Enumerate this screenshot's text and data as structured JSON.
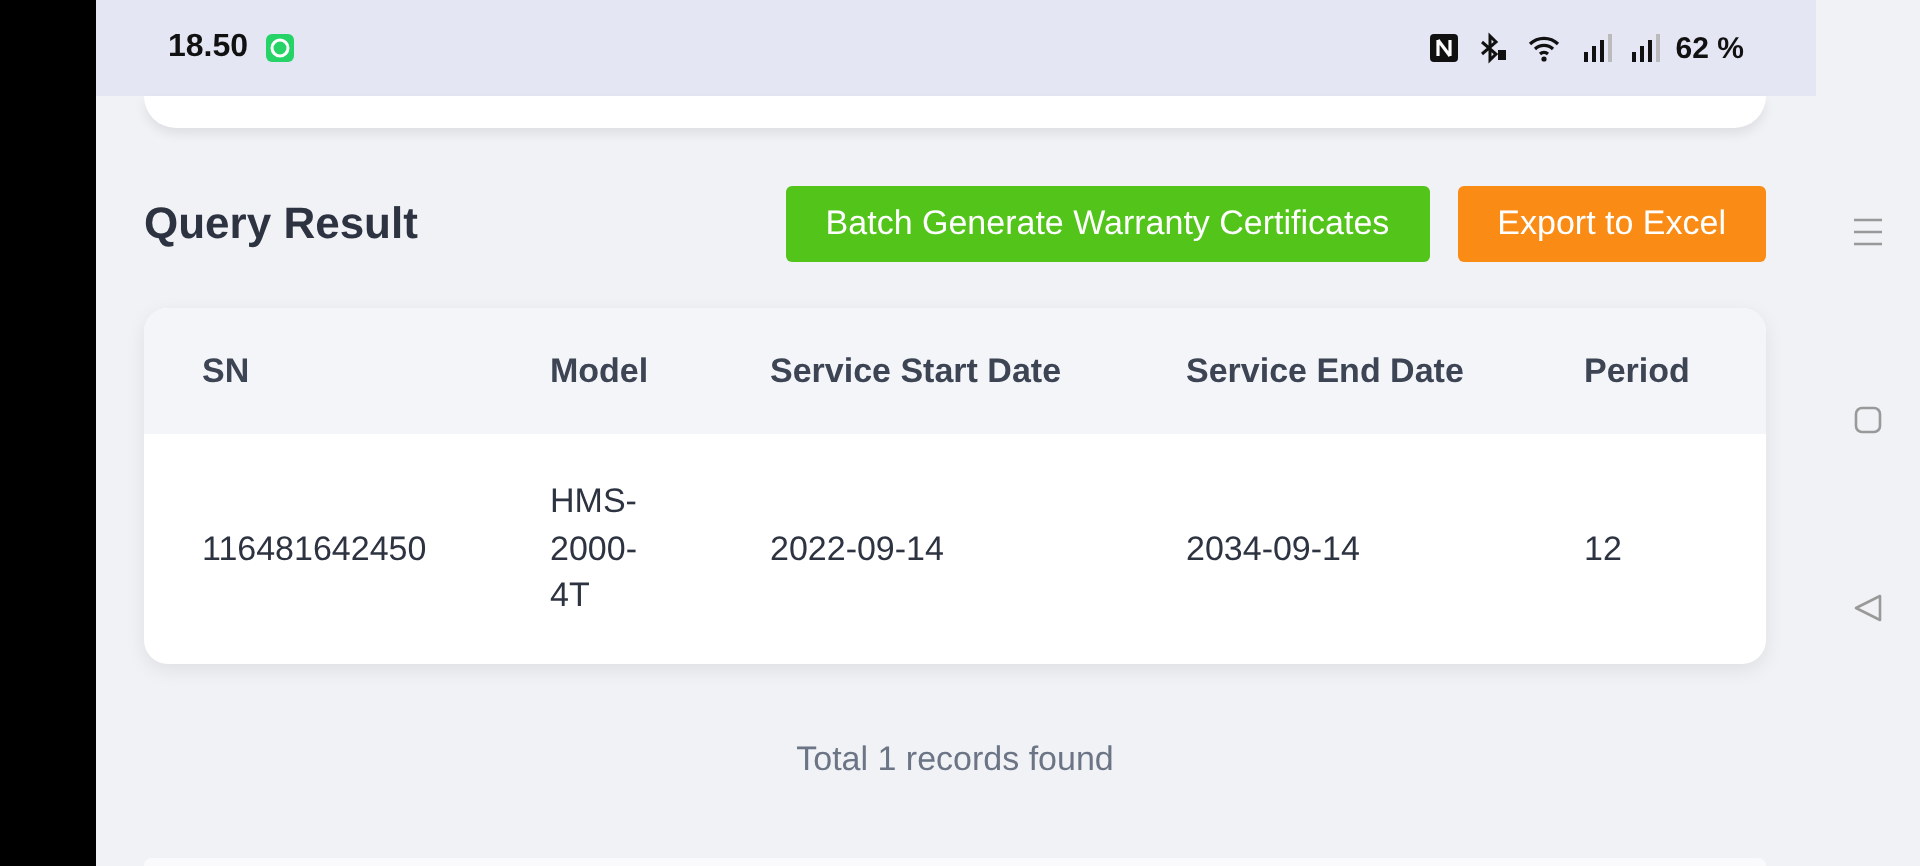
{
  "status_bar": {
    "time": "18.50",
    "battery": "62 %"
  },
  "section_title": "Query Result",
  "buttons": [
    {
      "label": "Batch Generate Warranty Certificates",
      "kind": "primary"
    },
    {
      "label": "Export to Excel",
      "kind": "export"
    }
  ],
  "table": {
    "columns": [
      "SN",
      "Model",
      "Service Start Date",
      "Service End Date",
      "Period"
    ],
    "rows": [
      [
        "116481642450",
        "HMS-2000-4T",
        "2022-09-14",
        "2034-09-14",
        "12"
      ]
    ]
  },
  "footer": "Total 1 records found"
}
